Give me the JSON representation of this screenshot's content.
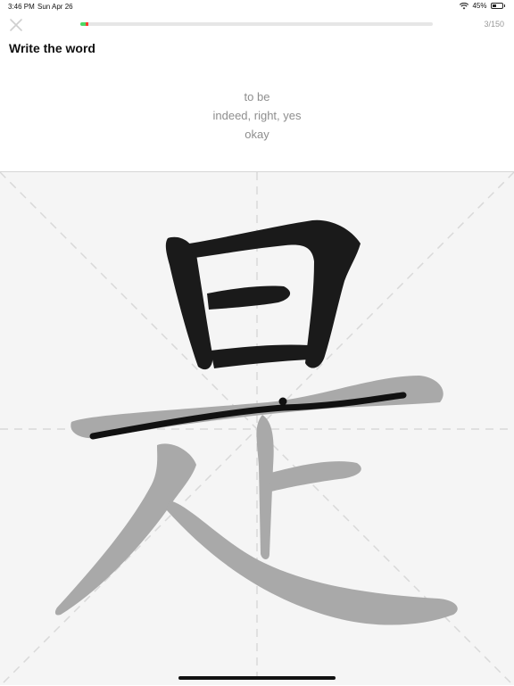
{
  "status_bar": {
    "time": "3:46 PM",
    "date": "Sun Apr 26",
    "battery_text": "45%",
    "battery_level": 0.45,
    "wifi_icon": "wifi-icon",
    "battery_icon": "battery-icon"
  },
  "toolbar": {
    "close_icon": "close-icon",
    "progress_current": 3,
    "progress_total": 150,
    "progress_label": "3/150",
    "progress_colors": {
      "correct": "#4cd964",
      "wrong": "#ff3b30",
      "track": "#e6e6e6"
    }
  },
  "prompt": {
    "title": "Write the word",
    "definitions": [
      "to be",
      "indeed, right, yes",
      "okay"
    ]
  },
  "canvas": {
    "character": "是",
    "background": "#f5f5f5",
    "guide_color": "#d9d9d9",
    "completed_stroke_color": "#1a1a1a",
    "hint_stroke_color": "#a9a9a9",
    "user_stroke_color": "#111111"
  }
}
